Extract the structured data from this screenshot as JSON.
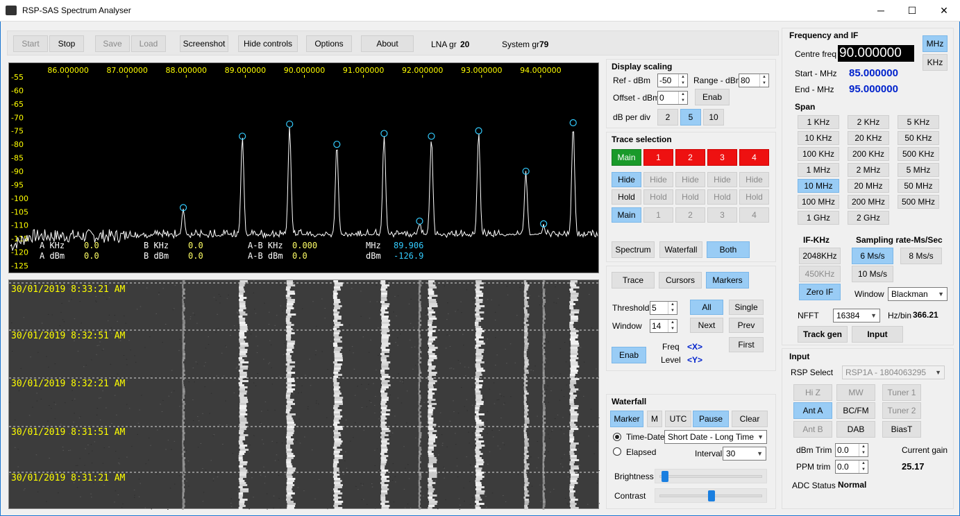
{
  "window": {
    "title": "RSP-SAS Spectrum Analyser",
    "min": "─",
    "max": "☐",
    "close": "✕"
  },
  "toolbar": {
    "start": "Start",
    "stop": "Stop",
    "save": "Save",
    "load": "Load",
    "screenshot": "Screenshot",
    "hide_controls": "Hide controls",
    "options": "Options",
    "about": "About",
    "lna_label": "LNA gr",
    "lna_value": "20",
    "system_label": "System gr",
    "system_value": "79"
  },
  "spectrum": {
    "freq_labels": [
      "86.000000",
      "87.000000",
      "88.000000",
      "89.000000",
      "90.000000",
      "91.000000",
      "92.000000",
      "93.000000",
      "94.000000"
    ],
    "db_labels": [
      "-55",
      "-60",
      "-65",
      "-70",
      "-75",
      "-80",
      "-85",
      "-90",
      "-95",
      "-100",
      "-105",
      "-110",
      "-115",
      "-120",
      "-125"
    ],
    "freq_range": [
      85.0,
      95.0
    ],
    "db_range": [
      -55,
      -125
    ],
    "peaks": [
      {
        "f": 87.95,
        "db": -104
      },
      {
        "f": 88.95,
        "db": -77.5
      },
      {
        "f": 89.75,
        "db": -73
      },
      {
        "f": 90.55,
        "db": -80.5
      },
      {
        "f": 91.35,
        "db": -76.5
      },
      {
        "f": 91.95,
        "db": -109
      },
      {
        "f": 92.15,
        "db": -77.5
      },
      {
        "f": 92.95,
        "db": -75.5
      },
      {
        "f": 93.75,
        "db": -90.5
      },
      {
        "f": 94.05,
        "db": -110
      },
      {
        "f": 94.55,
        "db": -72.5
      }
    ],
    "noise_floor": -114,
    "readout": {
      "a_khz_label": "A KHz",
      "a_khz": "0.0",
      "a_dbm_label": "A dBm",
      "a_dbm": "0.0",
      "b_khz_label": "B KHz",
      "b_khz": "0.0",
      "b_dbm_label": "B dBm",
      "b_dbm": "0.0",
      "ab_khz_label": "A-B KHz",
      "ab_khz": "0.000",
      "ab_dbm_label": "A-B dBm",
      "ab_dbm": "0.0",
      "mhz_label": "MHz",
      "mhz": "89.906",
      "dbm_label": "dBm",
      "dbm": "-126.9"
    },
    "trace_color": "#ffffff",
    "marker_color": "#33ccff",
    "freq_label_color": "#ffff00"
  },
  "waterfall": {
    "timestamps": [
      "30/01/2019   8:33:21 AM",
      "30/01/2019   8:32:51 AM",
      "30/01/2019   8:32:21 AM",
      "30/01/2019   8:31:51 AM",
      "30/01/2019   8:31:21 AM"
    ]
  },
  "display_scaling": {
    "title": "Display scaling",
    "ref_label": "Ref - dBm",
    "ref": "-50",
    "range_label": "Range - dBm",
    "range": "80",
    "offset_label": "Offset - dBm",
    "offset": "0",
    "enab": "Enab",
    "dbdiv_label": "dB per div",
    "d2": "2",
    "d5": "5",
    "d10": "10"
  },
  "trace_selection": {
    "title": "Trace selection",
    "traces": [
      "Main",
      "1",
      "2",
      "3",
      "4"
    ],
    "hide": "Hide",
    "hold": "Hold",
    "row3": [
      "Main",
      "1",
      "2",
      "3",
      "4"
    ],
    "spectrum": "Spectrum",
    "waterfall": "Waterfall",
    "both": "Both"
  },
  "markers": {
    "trace": "Trace",
    "cursors": "Cursors",
    "markers": "Markers",
    "threshold_label": "Threshold",
    "threshold": "5",
    "window_label": "Window",
    "window": "14",
    "all": "All",
    "single": "Single",
    "next": "Next",
    "prev": "Prev",
    "first": "First",
    "enab": "Enab",
    "freq_label": "Freq",
    "freq_val": "<X>",
    "level_label": "Level",
    "level_val": "<Y>"
  },
  "waterfall_panel": {
    "title": "Waterfall",
    "marker": "Marker",
    "m": "M",
    "utc": "UTC",
    "pause": "Pause",
    "clear": "Clear",
    "timedate": "Time-Date",
    "elapsed": "Elapsed",
    "format": "Short Date - Long Time",
    "interval_label": "Interval",
    "interval": "30",
    "brightness": "Brightness",
    "contrast": "Contrast",
    "brightness_level": 0.02,
    "contrast_level": 0.5
  },
  "freq_if": {
    "title": "Frequency and IF",
    "centre_label": "Centre freq",
    "centre": "90.000000",
    "mhz": "MHz",
    "khz": "KHz",
    "start_label": "Start - MHz",
    "start": "85.000000",
    "end_label": "End - MHz",
    "end": "95.000000",
    "span_label": "Span",
    "spans": [
      "1 KHz",
      "2 KHz",
      "5 KHz",
      "10 KHz",
      "20 KHz",
      "50 KHz",
      "100 KHz",
      "200 KHz",
      "500 KHz",
      "1 MHz",
      "2 MHz",
      "5 MHz",
      "10 MHz",
      "20 MHz",
      "50 MHz",
      "100 MHz",
      "200 MHz",
      "500 MHz",
      "1 GHz",
      "2 GHz"
    ],
    "if_label": "IF-KHz",
    "if1": "2048KHz",
    "if2": "450KHz",
    "zero_if": "Zero IF",
    "sr_label": "Sampling rate-Ms/Sec",
    "sr6": "6 Ms/s",
    "sr8": "8 Ms/s",
    "sr10": "10 Ms/s",
    "window_label": "Window",
    "window": "Blackman",
    "nfft_label": "NFFT",
    "nfft": "16384",
    "hzbin_label": "Hz/bin",
    "hzbin": "366.21",
    "track_gen": "Track gen",
    "input": "Input"
  },
  "input": {
    "title": "Input",
    "rsp_label": "RSP Select",
    "rsp": "RSP1A - 1804063295",
    "hiz": "Hi Z",
    "mw": "MW",
    "tuner1": "Tuner 1",
    "anta": "Ant A",
    "bcfm": "BC/FM",
    "tuner2": "Tuner 2",
    "antb": "Ant B",
    "dab": "DAB",
    "biast": "BiasT",
    "dbm_trim_label": "dBm Trim",
    "dbm_trim": "0.0",
    "ppm_trim_label": "PPM trim",
    "ppm_trim": "0.0",
    "gain_label": "Current gain",
    "gain": "25.17",
    "adc_label": "ADC Status",
    "adc": "Normal"
  }
}
